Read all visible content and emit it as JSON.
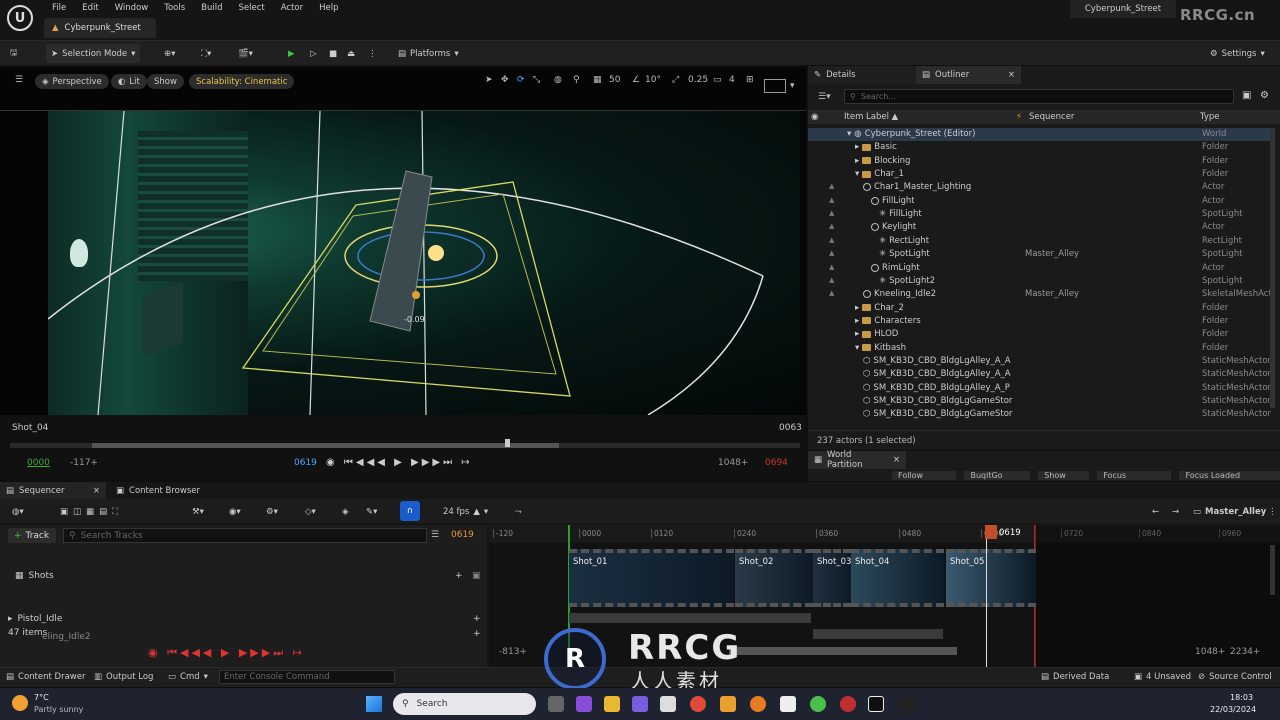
{
  "menubar": {
    "items": [
      "File",
      "Edit",
      "Window",
      "Tools",
      "Build",
      "Select",
      "Actor",
      "Help"
    ],
    "level_tab": "Cyberpunk_Street",
    "project": "Cyberpunk_Street",
    "watermark": "RRCG.cn"
  },
  "toolbar": {
    "selection_mode": "Selection Mode",
    "platforms": "Platforms",
    "settings": "Settings"
  },
  "viewport": {
    "perspective": "Perspective",
    "lit": "Lit",
    "show": "Show",
    "scalability": "Scalability: Cinematic",
    "grid": "50",
    "angle": "10°",
    "scale": "0.25",
    "cam_speed": "4",
    "label_value": "-0.09",
    "shot_name": "Shot_04",
    "end_frame": "0063",
    "tl_start": "0000",
    "tl_left": "-117+",
    "tl_current": "0619",
    "tl_right": "1048+",
    "tl_end": "0694"
  },
  "panel": {
    "details_tab": "Details",
    "outliner_tab": "Outliner",
    "search_placeholder": "Search...",
    "col_label": "Item Label ▲",
    "col_seq": "Sequencer",
    "col_type": "Type",
    "actors_count": "237 actors (1 selected)",
    "wp_tab": "World Partition",
    "wp_buttons": [
      "Follow Player",
      "BuqitGo Load",
      "Show Cell",
      "Focus Selection",
      "Focus Loaded Regions"
    ]
  },
  "outliner": [
    {
      "label": "Cyberpunk_Street (Editor)",
      "seq": "",
      "type": "World",
      "indent": 3,
      "kind": "world"
    },
    {
      "label": "Basic",
      "seq": "",
      "type": "Folder",
      "indent": 4,
      "kind": "folder"
    },
    {
      "label": "Blocking",
      "seq": "",
      "type": "Folder",
      "indent": 4,
      "kind": "folder"
    },
    {
      "label": "Char_1",
      "seq": "",
      "type": "Folder",
      "indent": 4,
      "kind": "folder"
    },
    {
      "label": "Char1_Master_Lighting",
      "seq": "",
      "type": "Actor",
      "indent": 5,
      "kind": "actor"
    },
    {
      "label": "FillLight",
      "seq": "",
      "type": "Actor",
      "indent": 6,
      "kind": "actor"
    },
    {
      "label": "FillLight",
      "seq": "",
      "type": "SpotLight",
      "indent": 7,
      "kind": "light"
    },
    {
      "label": "Keylight",
      "seq": "",
      "type": "Actor",
      "indent": 6,
      "kind": "actor"
    },
    {
      "label": "RectLight",
      "seq": "",
      "type": "RectLight",
      "indent": 7,
      "kind": "light"
    },
    {
      "label": "SpotLight",
      "seq": "Master_Alley",
      "type": "SpotLight",
      "indent": 7,
      "kind": "light"
    },
    {
      "label": "RimLight",
      "seq": "",
      "type": "Actor",
      "indent": 6,
      "kind": "actor"
    },
    {
      "label": "SpotLight2",
      "seq": "",
      "type": "SpotLight",
      "indent": 7,
      "kind": "light"
    },
    {
      "label": "Kneeling_Idle2",
      "seq": "Master_Alley",
      "type": "SkeletalMeshAct",
      "indent": 5,
      "kind": "actor"
    },
    {
      "label": "Char_2",
      "seq": "",
      "type": "Folder",
      "indent": 4,
      "kind": "folder"
    },
    {
      "label": "Characters",
      "seq": "",
      "type": "Folder",
      "indent": 4,
      "kind": "folder"
    },
    {
      "label": "HLOD",
      "seq": "",
      "type": "Folder",
      "indent": 4,
      "kind": "folder"
    },
    {
      "label": "Kitbash",
      "seq": "",
      "type": "Folder",
      "indent": 4,
      "kind": "folder"
    },
    {
      "label": "SM_KB3D_CBD_BldgLgAlley_A_A",
      "seq": "",
      "type": "StaticMeshActor",
      "indent": 5,
      "kind": "mesh"
    },
    {
      "label": "SM_KB3D_CBD_BldgLgAlley_A_A",
      "seq": "",
      "type": "StaticMeshActor",
      "indent": 5,
      "kind": "mesh"
    },
    {
      "label": "SM_KB3D_CBD_BldgLgAlley_A_P",
      "seq": "",
      "type": "StaticMeshActor",
      "indent": 5,
      "kind": "mesh"
    },
    {
      "label": "SM_KB3D_CBD_BldgLgGameStor",
      "seq": "",
      "type": "StaticMeshActor",
      "indent": 5,
      "kind": "mesh"
    },
    {
      "label": "SM_KB3D_CBD_BldgLgGameStor",
      "seq": "",
      "type": "StaticMeshActor",
      "indent": 5,
      "kind": "mesh"
    }
  ],
  "sequencer": {
    "tab": "Sequencer",
    "content_browser": "Content Browser",
    "fps": "24 fps",
    "track_btn": "Track",
    "search_tracks": "Search Tracks",
    "frame": "0619",
    "sequence_name": "Master_Alley",
    "shots_label": "Shots",
    "pistol_label": "Pistol_Idle",
    "items_count": "47 items",
    "kneeling_label": "eling_Idle2",
    "ticks": [
      "-120",
      "0000",
      "0120",
      "0240",
      "0360",
      "0480",
      "0600",
      "0720",
      "0840",
      "0960"
    ],
    "playhead": "0619",
    "range_left": "-813+",
    "range_right": "1048+",
    "range_end": "2234+",
    "shots": [
      {
        "name": "Shot_01"
      },
      {
        "name": "Shot_02"
      },
      {
        "name": "Shot_03"
      },
      {
        "name": "Shot_04"
      },
      {
        "name": "Shot_05"
      }
    ]
  },
  "statusbar": {
    "content_drawer": "Content Drawer",
    "output_log": "Output Log",
    "cmd": "Cmd",
    "console_placeholder": "Enter Console Command",
    "derived": "Derived Data",
    "unsaved": "4 Unsaved",
    "source": "Source Control"
  },
  "taskbar": {
    "temp": "7°C",
    "weather": "Partly sunny",
    "search": "Search",
    "time": "18:03",
    "date": "22/03/2024"
  },
  "overlay": {
    "brand": "RRCG",
    "brand_cn": "人人素材"
  }
}
